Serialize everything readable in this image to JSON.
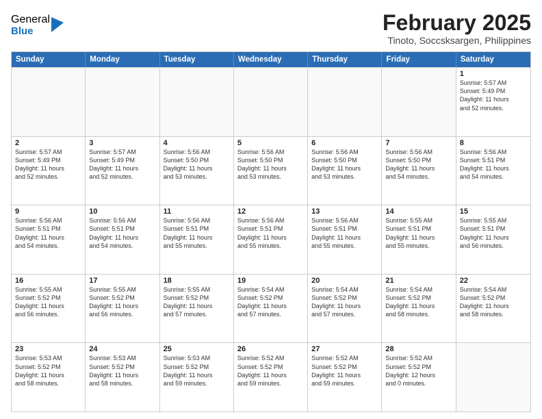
{
  "logo": {
    "general": "General",
    "blue": "Blue"
  },
  "title": "February 2025",
  "subtitle": "Tinoto, Soccsksargen, Philippines",
  "header_days": [
    "Sunday",
    "Monday",
    "Tuesday",
    "Wednesday",
    "Thursday",
    "Friday",
    "Saturday"
  ],
  "weeks": [
    [
      {
        "day": "",
        "text": ""
      },
      {
        "day": "",
        "text": ""
      },
      {
        "day": "",
        "text": ""
      },
      {
        "day": "",
        "text": ""
      },
      {
        "day": "",
        "text": ""
      },
      {
        "day": "",
        "text": ""
      },
      {
        "day": "1",
        "text": "Sunrise: 5:57 AM\nSunset: 5:49 PM\nDaylight: 11 hours\nand 52 minutes."
      }
    ],
    [
      {
        "day": "2",
        "text": "Sunrise: 5:57 AM\nSunset: 5:49 PM\nDaylight: 11 hours\nand 52 minutes."
      },
      {
        "day": "3",
        "text": "Sunrise: 5:57 AM\nSunset: 5:49 PM\nDaylight: 11 hours\nand 52 minutes."
      },
      {
        "day": "4",
        "text": "Sunrise: 5:56 AM\nSunset: 5:50 PM\nDaylight: 11 hours\nand 53 minutes."
      },
      {
        "day": "5",
        "text": "Sunrise: 5:56 AM\nSunset: 5:50 PM\nDaylight: 11 hours\nand 53 minutes."
      },
      {
        "day": "6",
        "text": "Sunrise: 5:56 AM\nSunset: 5:50 PM\nDaylight: 11 hours\nand 53 minutes."
      },
      {
        "day": "7",
        "text": "Sunrise: 5:56 AM\nSunset: 5:50 PM\nDaylight: 11 hours\nand 54 minutes."
      },
      {
        "day": "8",
        "text": "Sunrise: 5:56 AM\nSunset: 5:51 PM\nDaylight: 11 hours\nand 54 minutes."
      }
    ],
    [
      {
        "day": "9",
        "text": "Sunrise: 5:56 AM\nSunset: 5:51 PM\nDaylight: 11 hours\nand 54 minutes."
      },
      {
        "day": "10",
        "text": "Sunrise: 5:56 AM\nSunset: 5:51 PM\nDaylight: 11 hours\nand 54 minutes."
      },
      {
        "day": "11",
        "text": "Sunrise: 5:56 AM\nSunset: 5:51 PM\nDaylight: 11 hours\nand 55 minutes."
      },
      {
        "day": "12",
        "text": "Sunrise: 5:56 AM\nSunset: 5:51 PM\nDaylight: 11 hours\nand 55 minutes."
      },
      {
        "day": "13",
        "text": "Sunrise: 5:56 AM\nSunset: 5:51 PM\nDaylight: 11 hours\nand 55 minutes."
      },
      {
        "day": "14",
        "text": "Sunrise: 5:55 AM\nSunset: 5:51 PM\nDaylight: 11 hours\nand 55 minutes."
      },
      {
        "day": "15",
        "text": "Sunrise: 5:55 AM\nSunset: 5:51 PM\nDaylight: 11 hours\nand 56 minutes."
      }
    ],
    [
      {
        "day": "16",
        "text": "Sunrise: 5:55 AM\nSunset: 5:52 PM\nDaylight: 11 hours\nand 56 minutes."
      },
      {
        "day": "17",
        "text": "Sunrise: 5:55 AM\nSunset: 5:52 PM\nDaylight: 11 hours\nand 56 minutes."
      },
      {
        "day": "18",
        "text": "Sunrise: 5:55 AM\nSunset: 5:52 PM\nDaylight: 11 hours\nand 57 minutes."
      },
      {
        "day": "19",
        "text": "Sunrise: 5:54 AM\nSunset: 5:52 PM\nDaylight: 11 hours\nand 57 minutes."
      },
      {
        "day": "20",
        "text": "Sunrise: 5:54 AM\nSunset: 5:52 PM\nDaylight: 11 hours\nand 57 minutes."
      },
      {
        "day": "21",
        "text": "Sunrise: 5:54 AM\nSunset: 5:52 PM\nDaylight: 11 hours\nand 58 minutes."
      },
      {
        "day": "22",
        "text": "Sunrise: 5:54 AM\nSunset: 5:52 PM\nDaylight: 11 hours\nand 58 minutes."
      }
    ],
    [
      {
        "day": "23",
        "text": "Sunrise: 5:53 AM\nSunset: 5:52 PM\nDaylight: 11 hours\nand 58 minutes."
      },
      {
        "day": "24",
        "text": "Sunrise: 5:53 AM\nSunset: 5:52 PM\nDaylight: 11 hours\nand 58 minutes."
      },
      {
        "day": "25",
        "text": "Sunrise: 5:53 AM\nSunset: 5:52 PM\nDaylight: 11 hours\nand 59 minutes."
      },
      {
        "day": "26",
        "text": "Sunrise: 5:52 AM\nSunset: 5:52 PM\nDaylight: 11 hours\nand 59 minutes."
      },
      {
        "day": "27",
        "text": "Sunrise: 5:52 AM\nSunset: 5:52 PM\nDaylight: 11 hours\nand 59 minutes."
      },
      {
        "day": "28",
        "text": "Sunrise: 5:52 AM\nSunset: 5:52 PM\nDaylight: 12 hours\nand 0 minutes."
      },
      {
        "day": "",
        "text": ""
      }
    ]
  ]
}
